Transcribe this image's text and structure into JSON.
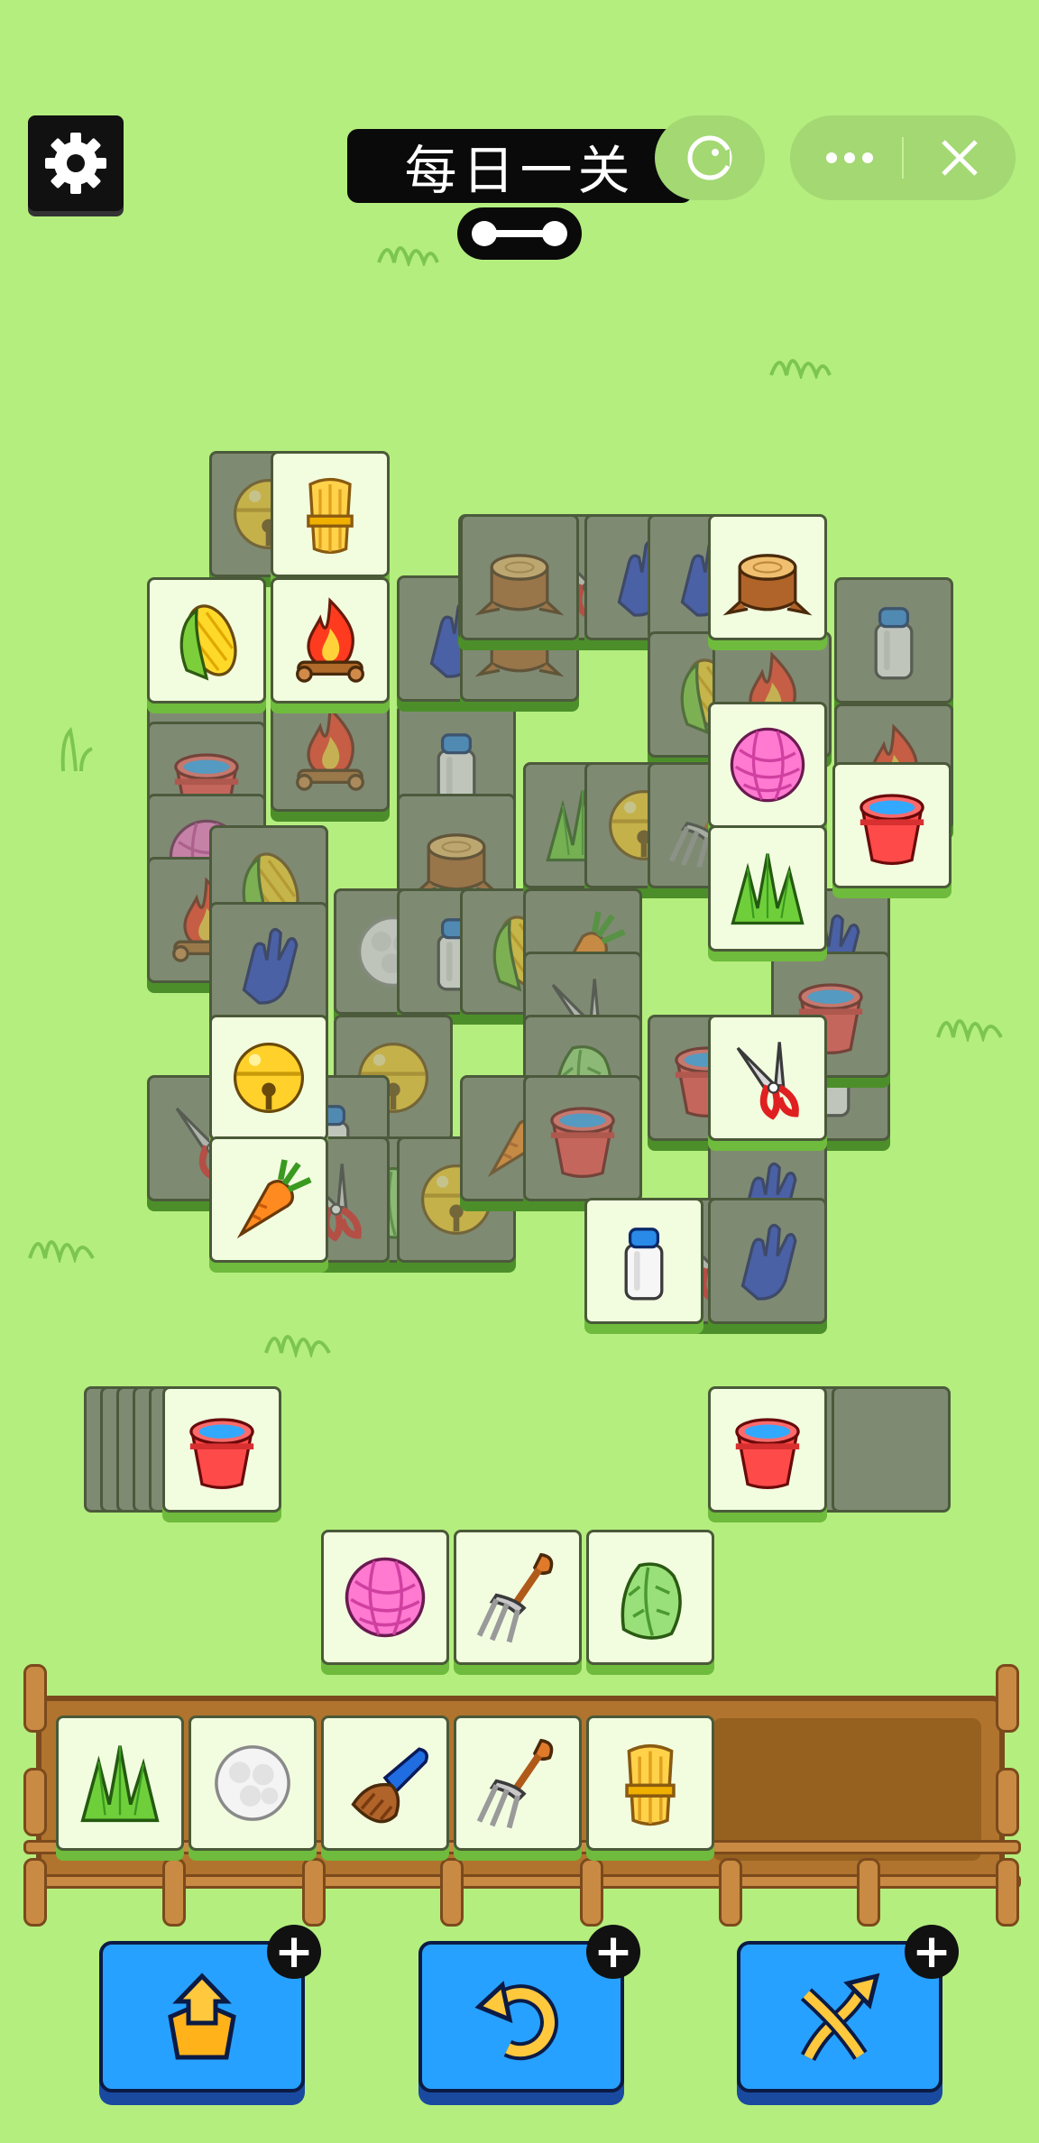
{
  "header": {
    "title": "每日一关",
    "icons": {
      "settings": "gear-icon",
      "capsule_left": "mini-program-icon",
      "more": "more-icon",
      "close": "close-icon"
    }
  },
  "board": {
    "tile_kinds": [
      "corn",
      "wheat",
      "fire",
      "glove",
      "stump",
      "bucket",
      "yarn",
      "grass",
      "pliers",
      "carrot",
      "bell",
      "milk",
      "cabbage",
      "rake",
      "brush",
      "cotton"
    ]
  },
  "side_stacks": {
    "left_top_tile": "bucket",
    "right_top_tile": "bucket"
  },
  "middle_row": [
    "yarn",
    "rake",
    "cabbage"
  ],
  "tray": {
    "capacity": 7,
    "items": [
      "grass",
      "cotton",
      "brush",
      "rake",
      "wheat"
    ]
  },
  "tools": [
    {
      "name": "move-out",
      "icon": "move-out-icon"
    },
    {
      "name": "undo",
      "icon": "undo-icon"
    },
    {
      "name": "shuffle",
      "icon": "shuffle-icon"
    }
  ],
  "colors": {
    "background": "#b4ee7e",
    "tile_face": "#f2fde0",
    "tile_covered": "#7f8a73",
    "tool_button": "#27a1ff"
  }
}
